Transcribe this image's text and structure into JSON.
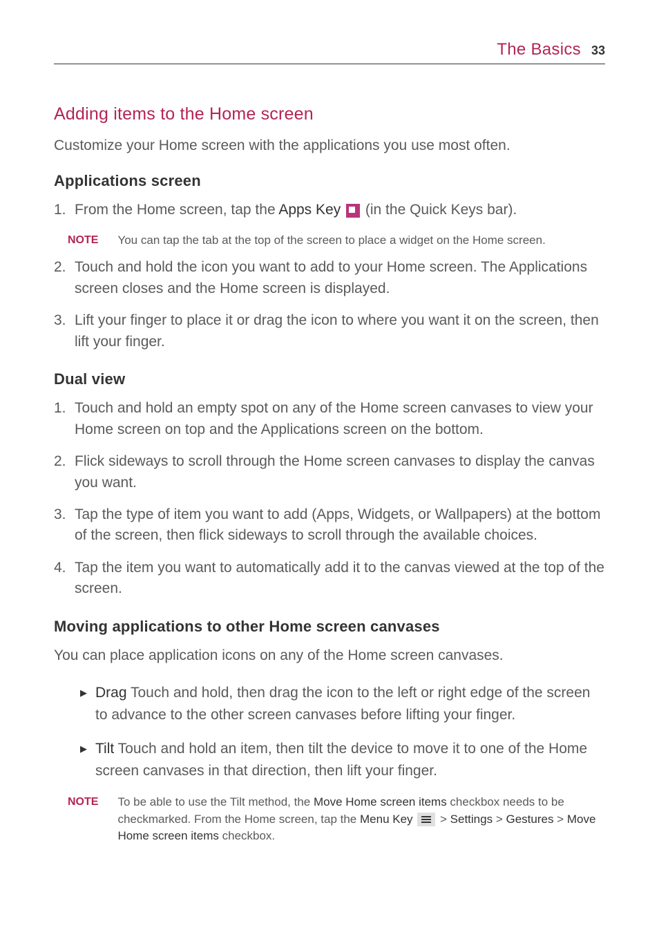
{
  "header": {
    "title": "The Basics",
    "page": "33"
  },
  "s1": {
    "title": "Adding items to the Home screen",
    "intro": "Customize your Home screen with the applications you use most often."
  },
  "s2": {
    "title": "Applications screen",
    "item1_prefix": "From the Home screen, tap the ",
    "item1_apps": "Apps Key",
    "item1_suffix": " (in the Quick Keys bar).",
    "note_label": "NOTE",
    "note_text": "You can tap the tab at the top of the screen to place a widget on the Home screen.",
    "item2": "Touch and hold the icon you want to add to your Home screen. The Applications screen closes and the Home screen is displayed.",
    "item3": "Lift your finger to place it or drag the icon to where you want it on the screen, then lift your finger."
  },
  "s3": {
    "title": "Dual view",
    "item1": "Touch and hold an empty spot on any of the Home screen canvases to view your Home screen on top and the Applications screen on the bottom.",
    "item2": "Flick sideways to scroll through the Home screen canvases to display the canvas you want.",
    "item3": "Tap the type of item you want to add (Apps, Widgets, or Wallpapers) at the bottom of the screen, then flick sideways to scroll through the available choices.",
    "item4": "Tap the item you want to automatically add it to the canvas viewed at the top of the screen."
  },
  "s4": {
    "title": "Moving applications to other Home screen canvases",
    "intro": "You can place application icons on any of the Home screen canvases.",
    "drag_label": "Drag",
    "drag_text": "  Touch and hold, then drag the icon to the left or right edge of the screen to advance to the other screen canvases before lifting your finger.",
    "tilt_label": "Tilt",
    "tilt_text": "  Touch and hold an item, then tilt the device to move it to one of the Home screen canvases in that direction, then lift your finger.",
    "note_label": "NOTE",
    "note_p1": "To be able to use the Tilt method, the ",
    "note_b1": "Move Home screen items",
    "note_p2": " checkbox needs to be checkmarked. From the Home screen, tap the ",
    "note_b2": "Menu Key",
    "note_p3": " > ",
    "note_b3": "Settings",
    "note_p4": " > ",
    "note_b4": "Gestures",
    "note_p5": " > ",
    "note_b5": "Move Home screen items",
    "note_p6": " checkbox."
  },
  "nums": {
    "n1": "1.",
    "n2": "2.",
    "n3": "3.",
    "n4": "4."
  }
}
